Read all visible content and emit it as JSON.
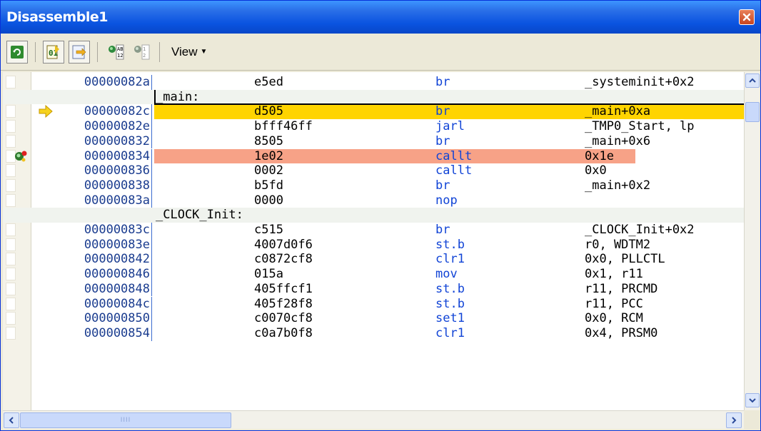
{
  "window": {
    "title": "Disassemble1"
  },
  "toolbar": {
    "view_label": "View",
    "buttons": [
      "refresh-icon",
      "code-display-icon",
      "jump-source-icon",
      "mix-display-icon",
      "instruction-display-icon"
    ]
  },
  "rows": [
    {
      "kind": "code",
      "addr": "00000082a",
      "code": "e5ed",
      "mnem": "br",
      "oper": "_systeminit+0x2"
    },
    {
      "kind": "label",
      "label": "_main:"
    },
    {
      "kind": "code",
      "addr": "00000082c",
      "code": "d505",
      "mnem": "br",
      "oper": "_main+0xa",
      "state": "current"
    },
    {
      "kind": "code",
      "addr": "00000082e",
      "code": "bfff46ff",
      "mnem": "jarl",
      "oper": "_TMP0_Start, lp"
    },
    {
      "kind": "code",
      "addr": "000000832",
      "code": "8505",
      "mnem": "br",
      "oper": "_main+0x6"
    },
    {
      "kind": "code",
      "addr": "000000834",
      "code": "1e02",
      "mnem": "callt",
      "oper": "0x1e",
      "state": "breakpoint"
    },
    {
      "kind": "code",
      "addr": "000000836",
      "code": "0002",
      "mnem": "callt",
      "oper": "0x0"
    },
    {
      "kind": "code",
      "addr": "000000838",
      "code": "b5fd",
      "mnem": "br",
      "oper": "_main+0x2"
    },
    {
      "kind": "code",
      "addr": "00000083a",
      "code": "0000",
      "mnem": "nop",
      "oper": ""
    },
    {
      "kind": "label",
      "label": "_CLOCK_Init:"
    },
    {
      "kind": "code",
      "addr": "00000083c",
      "code": "c515",
      "mnem": "br",
      "oper": "_CLOCK_Init+0x2"
    },
    {
      "kind": "code",
      "addr": "00000083e",
      "code": "4007d0f6",
      "mnem": "st.b",
      "oper": "r0, WDTM2"
    },
    {
      "kind": "code",
      "addr": "000000842",
      "code": "c0872cf8",
      "mnem": "clr1",
      "oper": "0x0, PLLCTL"
    },
    {
      "kind": "code",
      "addr": "000000846",
      "code": "015a",
      "mnem": "mov",
      "oper": "0x1, r11"
    },
    {
      "kind": "code",
      "addr": "000000848",
      "code": "405ffcf1",
      "mnem": "st.b",
      "oper": "r11, PRCMD"
    },
    {
      "kind": "code",
      "addr": "00000084c",
      "code": "405f28f8",
      "mnem": "st.b",
      "oper": "r11, PCC"
    },
    {
      "kind": "code",
      "addr": "000000850",
      "code": "c0070cf8",
      "mnem": "set1",
      "oper": "0x0, RCM"
    },
    {
      "kind": "code",
      "addr": "000000854",
      "code": "c0a7b0f8",
      "mnem": "clr1",
      "oper": "0x4, PRSM0"
    }
  ],
  "colors": {
    "current_line": "#ffd400",
    "breakpoint_line": "#f7a287",
    "mnemonic": "#1144d6",
    "address": "#1a3c8f"
  },
  "hscroll": {
    "grip": "IIII"
  }
}
